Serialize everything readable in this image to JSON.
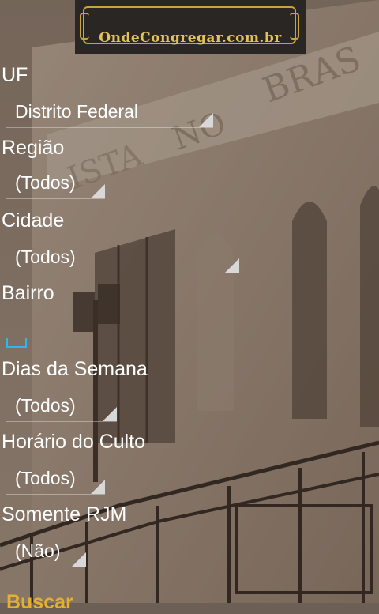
{
  "header": {
    "title": "OndeCongregar.com.br"
  },
  "form": {
    "uf": {
      "label": "UF",
      "value": "Distrito Federal"
    },
    "regiao": {
      "label": "Região",
      "value": "(Todos)"
    },
    "cidade": {
      "label": "Cidade",
      "value": "(Todos)"
    },
    "bairro": {
      "label": "Bairro",
      "value": ""
    },
    "dias": {
      "label": "Dias da Semana",
      "value": "(Todos)"
    },
    "horario": {
      "label": "Horário do Culto",
      "value": "(Todos)"
    },
    "rjm": {
      "label": "Somente RJM",
      "value": "(Não)"
    },
    "buscar_label": "Buscar"
  },
  "background": {
    "facade_text_1": "NO",
    "facade_text_2": "BRAS",
    "facade_text_3": "ISTA"
  },
  "colors": {
    "accent": "#33b5e5",
    "header_gold": "#c9a437",
    "button_text": "#e6b02e"
  }
}
